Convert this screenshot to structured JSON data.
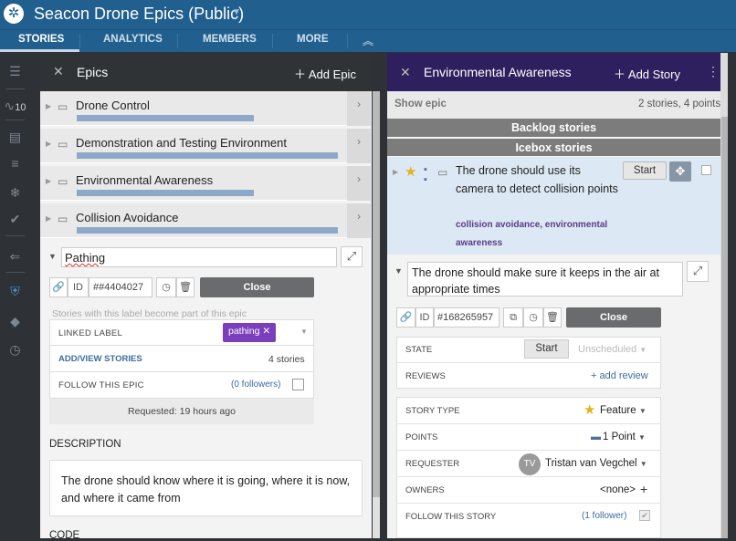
{
  "app": {
    "project_title": "Seacon Drone Epics (Public)",
    "logo_icon": "gear-logo-icon",
    "tabs": [
      "STORIES",
      "ANALYTICS",
      "MEMBERS",
      "MORE"
    ],
    "active_tab": "STORIES"
  },
  "rail": {
    "velocity": "10",
    "icons": [
      "menu-icon",
      "velocity-icon",
      "inbox-icon",
      "list-icon",
      "snowflake-icon",
      "check-icon",
      "goto-icon",
      "epic-shield-icon",
      "label-icon",
      "history-icon"
    ]
  },
  "epics_panel": {
    "title": "Epics",
    "add_label": "Add Epic",
    "items": [
      {
        "name": "Drone Control",
        "progress": 0.68
      },
      {
        "name": "Demonstration and Testing Environment",
        "progress": 1.0
      },
      {
        "name": "Environmental Awareness",
        "progress": 0.68
      },
      {
        "name": "Collision Avoidance",
        "progress": 1.0
      }
    ],
    "expanded": {
      "name_value": "Pathing",
      "id_label": "ID",
      "id_value": "##4404027",
      "close_label": "Close",
      "stories_hint": "Stories with this label become part of this epic",
      "linked_label_caption": "LINKED LABEL",
      "linked_label_value": "pathing",
      "add_view_label": "ADD/VIEW STORIES",
      "story_count": "4 stories",
      "follow_label": "FOLLOW THIS EPIC",
      "followers": "(0 followers)",
      "requested": "Requested: 19 hours ago",
      "description_heading": "DESCRIPTION",
      "description": "The drone should know where it is going, where it is now, and where it came from",
      "code_heading": "CODE"
    }
  },
  "story_panel": {
    "title": "Environmental Awareness",
    "add_label": "Add Story",
    "show_epic_label": "Show epic",
    "summary": "2 stories, 4 points",
    "backlog_label": "Backlog stories",
    "icebox_label": "Icebox stories",
    "card1": {
      "title": "The drone should use its camera to detect collision points",
      "labels": "collision avoidance, environmental awareness",
      "start_label": "Start"
    },
    "card2": {
      "title": "The drone should make sure it keeps in the air at appropriate times",
      "id_label": "ID",
      "id_value": "#168265957",
      "close_label": "Close",
      "state_label": "STATE",
      "state_start": "Start",
      "state_value": "Unscheduled",
      "reviews_label": "REVIEWS",
      "add_review": "+ add review",
      "story_type_label": "STORY TYPE",
      "story_type_value": "Feature",
      "points_label": "POINTS",
      "points_value": "1 Point",
      "requester_label": "REQUESTER",
      "requester_initials": "TV",
      "requester_name": "Tristan van Vegchel",
      "owners_label": "OWNERS",
      "owners_value": "<none>",
      "follow_label": "FOLLOW THIS STORY",
      "followers": "(1 follower)"
    }
  },
  "colors": {
    "topbar": "#215f8e",
    "epic_header": "#2f3336",
    "story_header": "#2e1f5e",
    "label_chip": "#7b3fbd",
    "progress_bar": "#8ea9c8",
    "link_blue": "#3d6d9e"
  }
}
